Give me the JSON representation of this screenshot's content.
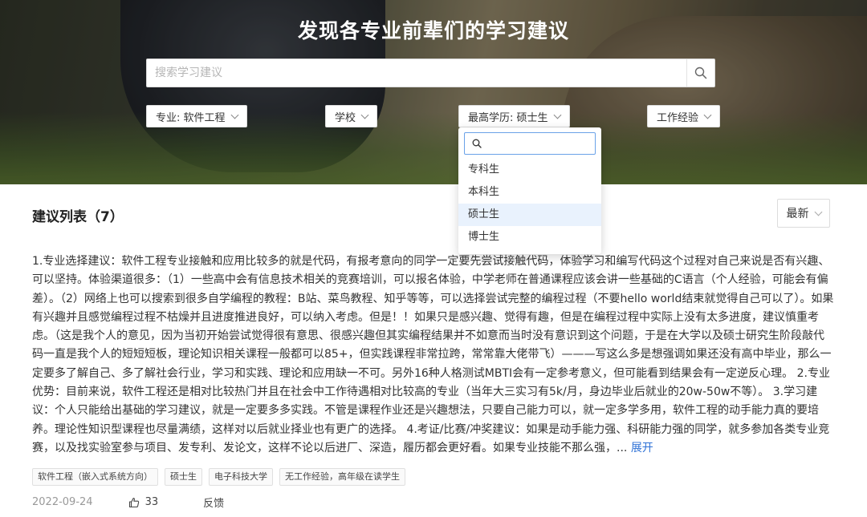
{
  "hero": {
    "title": "发现各专业前辈们的学习建议"
  },
  "search": {
    "placeholder": "搜索学习建议",
    "icon": "search-icon"
  },
  "filters": {
    "major": "专业: 软件工程",
    "school": "学校",
    "degree": "最高学历: 硕士生",
    "experience": "工作经验"
  },
  "degree_dropdown": {
    "search_value": "",
    "options": [
      "专科生",
      "本科生",
      "硕士生",
      "博士生"
    ],
    "selected": "硕士生"
  },
  "list": {
    "heading": "建议列表（7）",
    "sort_label": "最新"
  },
  "post": {
    "body": "1.专业选择建议：软件工程专业接触和应用比较多的就是代码，有报考意向的同学一定要先尝试接触代码，体验学习和编写代码这个过程对自己来说是否有兴趣、可以坚持。体验渠道很多：（1）一些高中会有信息技术相关的竞赛培训，可以报名体验，中学老师在普通课程应该会讲一些基础的C语言（个人经验，可能会有偏差）。（2）网络上也可以搜索到很多自学编程的教程：B站、菜鸟教程、知乎等等，可以选择尝试完整的编程过程（不要hello world结束就觉得自己可以了）。如果有兴趣并且感觉编程过程不枯燥并且进度推进良好，可以纳入考虑。但是！！如果只是感兴趣、觉得有趣，但是在编程过程中实际上没有太多进度，建议慎重考虑。（这是我个人的意见，因为当初开始尝试觉得很有意思、很感兴趣但其实编程结果并不如意而当时没有意识到这个问题，于是在大学以及硕士研究生阶段敲代码一直是我个人的短短短板，理论知识相关课程一般都可以85+，但实践课程非常拉跨，常常靠大佬带飞）———写这么多是想强调如果还没有高中毕业，那么一定要多了解自己、多了解社会行业，学习和实践、理论和应用缺一不可。另外16种人格测试MBTI会有一定参考意义，但可能看到结果会有一定逆反心理。 2.专业优势：目前来说，软件工程还是相对比较热门并且在社会中工作待遇相对比较高的专业（当年大三实习有5k/月，身边毕业后就业的20w-50w不等）。 3.学习建议：个人只能给出基础的学习建议，就是一定要多多实践。不管是课程作业还是兴趣想法，只要自己能力可以，就一定多学多用，软件工程的动手能力真的要培养。理论性知识型课程也尽量满绩，这样对以后就业择业也有更广的选择。 4.考证/比赛/冲奖建议：如果是动手能力强、科研能力强的同学，就多参加各类专业竞赛，以及找实验室参与项目、发专利、发论文，这样不论以后进厂、深造，履历都会更好看。如果专业技能不那么强，...",
    "expand_label": "展开",
    "tags": [
      "软件工程（嵌入式系统方向）",
      "硕士生",
      "电子科技大学",
      "无工作经验，高年级在读学生"
    ],
    "date": "2022-09-24",
    "likes": "33",
    "feedback_label": "反馈"
  },
  "colors": {
    "accent": "#2f72d6",
    "dropdown_active_bg": "#e9f2fd",
    "dropdown_search_border": "#6aa2e8"
  }
}
